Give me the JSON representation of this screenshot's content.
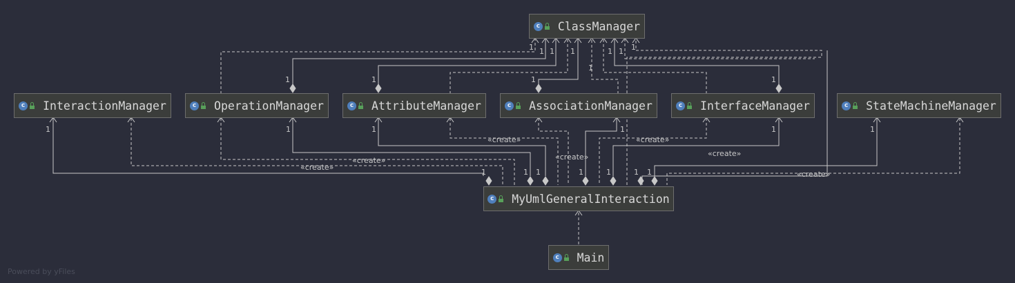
{
  "classes": {
    "class_manager": "ClassManager",
    "interaction_manager": "InteractionManager",
    "operation_manager": "OperationManager",
    "attribute_manager": "AttributeManager",
    "association_manager": "AssociationManager",
    "interface_manager": "InterfaceManager",
    "state_machine_manager": "StateMachineManager",
    "general_interaction": "MyUmlGeneralInteraction",
    "main": "Main"
  },
  "icons": {
    "class_icon_glyph": "c",
    "class_icon_color": "#4f7fbc",
    "visibility_icon_color": "#58a05a"
  },
  "labels": {
    "create": "«create»",
    "one": "1"
  },
  "watermark": "Powered by yFiles",
  "colors": {
    "background": "#2b2d3a",
    "node_fill": "#3b3d3b",
    "node_border": "#6e6e6e",
    "edge": "#c8c8c8",
    "text": "#d8d8d8"
  }
}
